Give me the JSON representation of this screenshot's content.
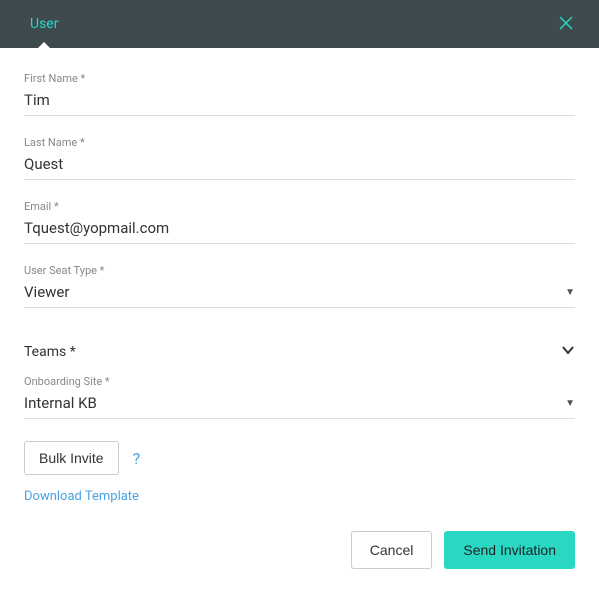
{
  "header": {
    "tab": "User"
  },
  "fields": {
    "firstName": {
      "label": "First Name *",
      "value": "Tim"
    },
    "lastName": {
      "label": "Last Name *",
      "value": "Quest"
    },
    "email": {
      "label": "Email *",
      "value": "Tquest@yopmail.com"
    },
    "seatType": {
      "label": "User Seat Type *",
      "value": "Viewer"
    },
    "teams": {
      "label": "Teams *"
    },
    "onboardingSite": {
      "label": "Onboarding Site *",
      "value": "Internal KB"
    }
  },
  "actions": {
    "bulkInvite": "Bulk Invite",
    "help": "?",
    "downloadTemplate": "Download Template"
  },
  "footer": {
    "cancel": "Cancel",
    "send": "Send Invitation"
  }
}
